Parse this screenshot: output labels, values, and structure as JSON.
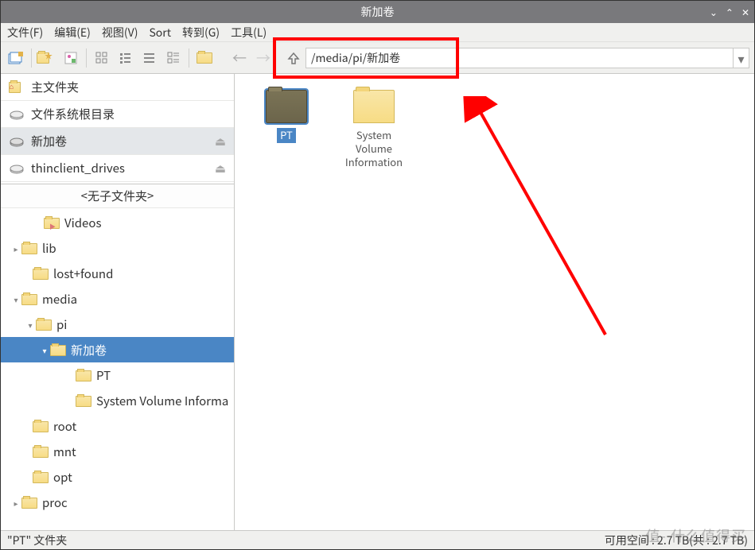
{
  "window": {
    "title": "新加卷"
  },
  "menubar": {
    "file": "文件(F)",
    "edit": "编辑(E)",
    "view": "视图(V)",
    "sort": "Sort",
    "go": "转到(G)",
    "tools": "工具(L)"
  },
  "path": {
    "value": "/media/pi/新加卷"
  },
  "places": {
    "home": "主文件夹",
    "root": "文件系统根目录",
    "vol": "新加卷",
    "thin": "thinclient_drives"
  },
  "tree": {
    "header": "<无子文件夹>",
    "videos": "Videos",
    "lib": "lib",
    "lostfound": "lost+found",
    "media": "media",
    "pi": "pi",
    "newvol": "新加卷",
    "pt": "PT",
    "svi": "System Volume Informa",
    "rootdir": "root",
    "mnt": "mnt",
    "opt": "opt",
    "proc": "proc"
  },
  "content": {
    "item1": "PT",
    "item2": "System Volume Information"
  },
  "statusbar": {
    "left": "\"PT\" 文件夹",
    "right": "可用空间 : 2.7 TB(共 : 2.7 TB)"
  },
  "watermark": "值- 什么值得买"
}
